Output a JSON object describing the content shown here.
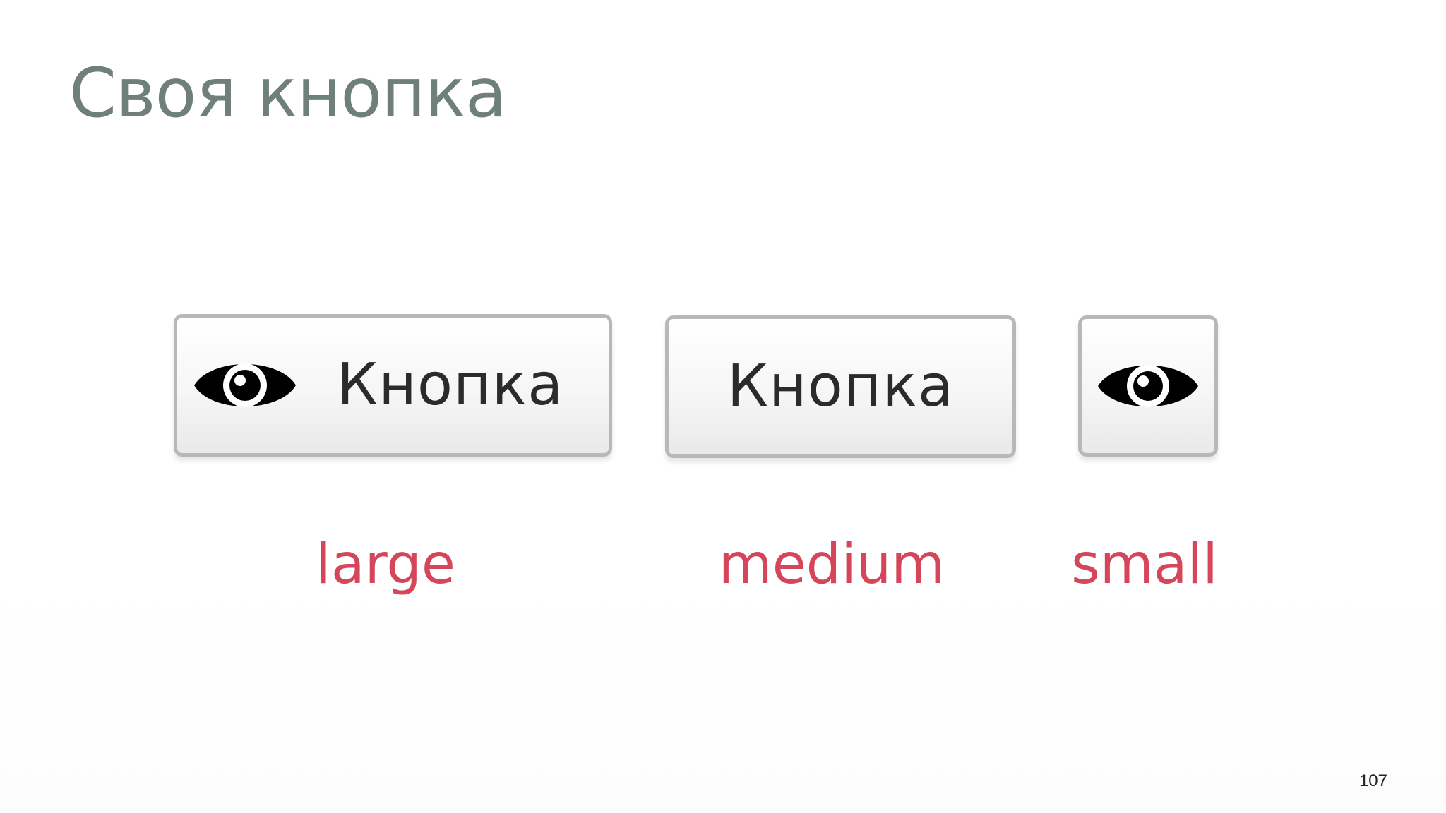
{
  "slide": {
    "title": "Своя кнопка",
    "page_number": "107"
  },
  "buttons": [
    {
      "size": "large",
      "label": "Кнопка",
      "icon": "eye-icon"
    },
    {
      "size": "medium",
      "label": "Кнопка"
    },
    {
      "size": "small",
      "icon": "eye-icon"
    }
  ],
  "size_labels": [
    "large",
    "medium",
    "small"
  ],
  "colors": {
    "title": "#6f7f7b",
    "accent": "#d6465a",
    "button_text": "#2b2b2b",
    "button_border": "#b8b8b8",
    "icon": "#000000"
  }
}
